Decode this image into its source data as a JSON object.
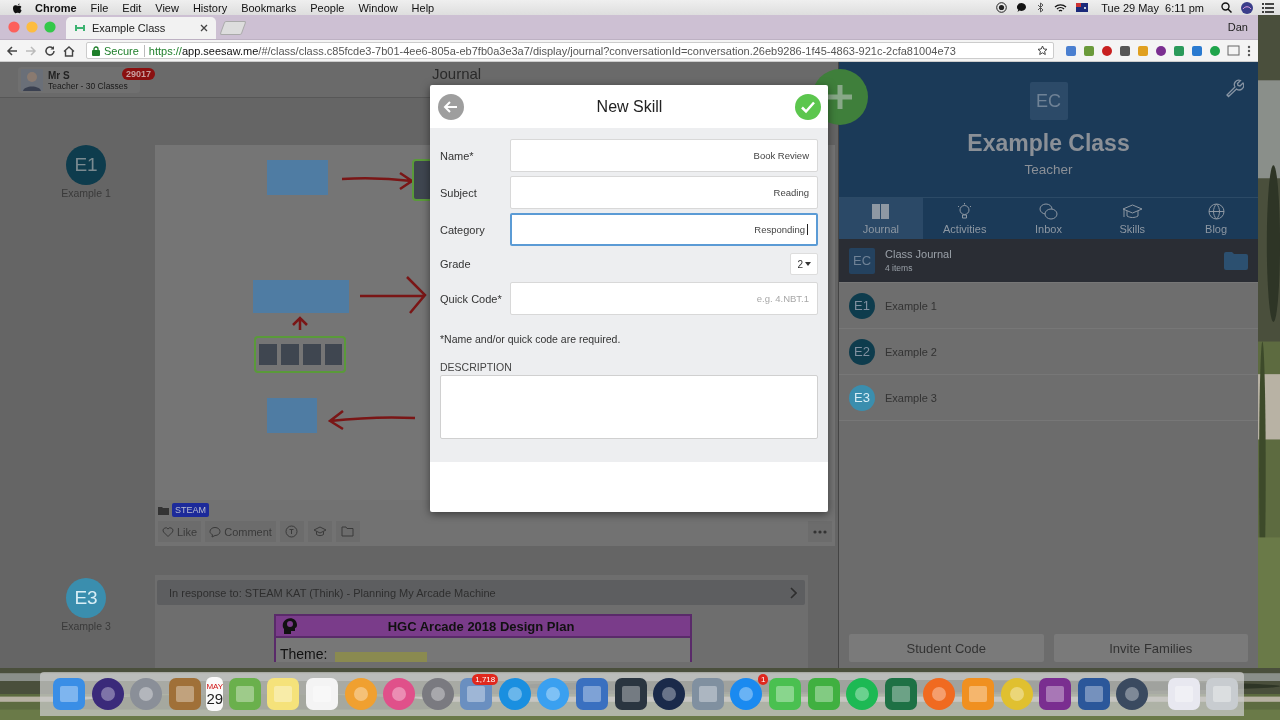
{
  "menubar": {
    "app": "Chrome",
    "menus": [
      "File",
      "Edit",
      "View",
      "History",
      "Bookmarks",
      "People",
      "Window",
      "Help"
    ],
    "clock": "Tue 29 May  6:11 pm"
  },
  "browser": {
    "tab": {
      "title": "Example Class"
    },
    "profile": "Dan",
    "secure": "Secure",
    "url": {
      "scheme": "https://",
      "host": "app.seesaw.me",
      "path": "/#/class/class.c85fcde3-7b01-4ee6-805a-eb7fb0a3e3a7/display/journal?conversationId=conversation.26eb9286-1f45-4863-921c-2cfa81004e73"
    }
  },
  "page": {
    "user": {
      "name": "Mr S",
      "role": "Teacher - 30 Classes",
      "badge": "29017"
    },
    "title": "Journal",
    "posts": [
      {
        "kind": "drawing",
        "student": {
          "initials": "E1",
          "name": "Example 1",
          "color": "#0e3c4d"
        },
        "folder": "STEAM",
        "actions": [
          "Like",
          "Comment"
        ]
      },
      {
        "kind": "response",
        "student": {
          "initials": "E3",
          "name": "Example 3",
          "color": "#3a8eae"
        },
        "response": "In response to: STEAM KAT (Think) - Planning My Arcade Machine",
        "document": {
          "title": "HGC Arcade 2018 Design Plan",
          "label": "Theme:"
        }
      }
    ]
  },
  "modal": {
    "title": "New Skill",
    "fields": [
      {
        "kind": "text",
        "label": "Name*",
        "value": "Book Review",
        "focused": false
      },
      {
        "kind": "text",
        "label": "Subject",
        "value": "Reading",
        "focused": false
      },
      {
        "kind": "text",
        "label": "Category",
        "value": "Responding",
        "focused": true
      },
      {
        "kind": "select",
        "label": "Grade",
        "value": "2"
      },
      {
        "kind": "text",
        "label": "Quick Code*",
        "placeholder": "e.g. 4.NBT.1",
        "focused": false
      }
    ],
    "note": "*Name and/or quick code are required.",
    "description_label": "DESCRIPTION"
  },
  "class_panel": {
    "initials": "EC",
    "name": "Example Class",
    "role": "Teacher",
    "tabs": [
      {
        "label": "Journal",
        "selected": true
      },
      {
        "label": "Activities",
        "selected": false
      },
      {
        "label": "Inbox",
        "selected": false
      },
      {
        "label": "Skills",
        "selected": false
      },
      {
        "label": "Blog",
        "selected": false
      }
    ],
    "items": [
      {
        "kind": "folder",
        "initials": "EC",
        "title": "Class Journal",
        "subtitle": "4 items",
        "selected": true
      },
      {
        "kind": "student",
        "initials": "E1",
        "title": "Example 1",
        "color": "#0e3c4d",
        "selected": false
      },
      {
        "kind": "student",
        "initials": "E2",
        "title": "Example 2",
        "color": "#0e3c4d",
        "selected": false
      },
      {
        "kind": "student",
        "initials": "E3",
        "title": "Example 3",
        "color": "#3a8eae",
        "selected": false
      }
    ],
    "buttons": [
      "Student Code",
      "Invite Families"
    ]
  },
  "dock": {
    "calendar_month": "MAY",
    "calendar_day": "29",
    "mail_badge": "1,718",
    "app_store_badge": "1"
  }
}
